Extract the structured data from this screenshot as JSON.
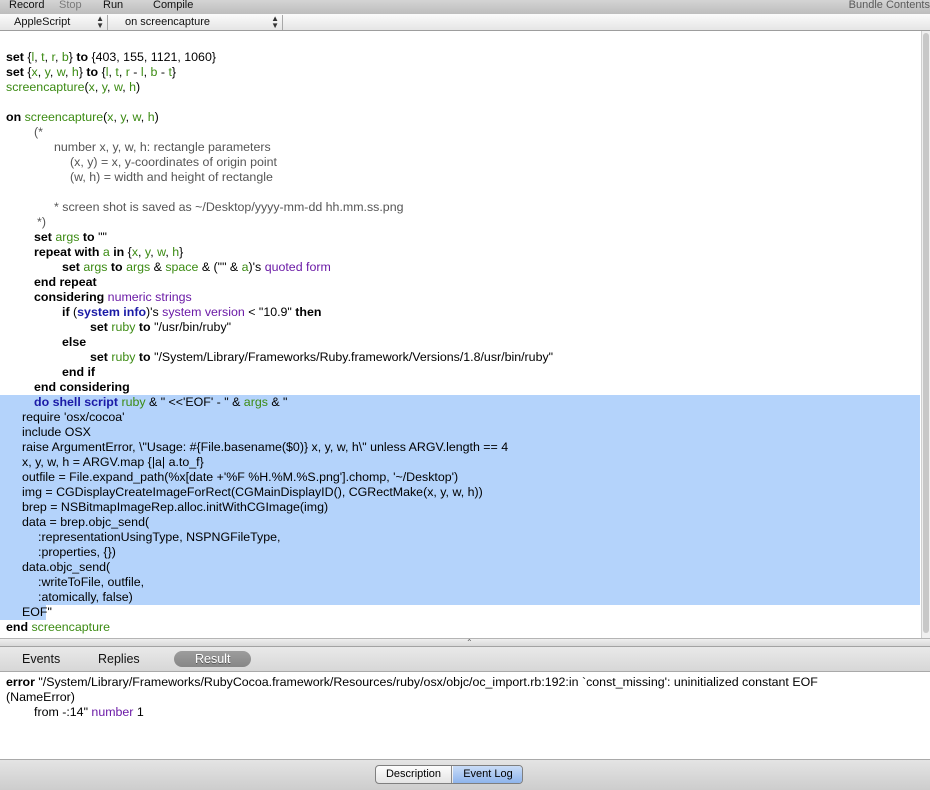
{
  "toolbar": {
    "record": "Record",
    "stop": "Stop",
    "run": "Run",
    "compile": "Compile",
    "bundle_contents": "Bundle Contents"
  },
  "navbar": {
    "language": "AppleScript",
    "handler": "on screencapture"
  },
  "code": {
    "l1": [
      "set ",
      "{",
      "l",
      ", ",
      "t",
      ", ",
      "r",
      ", ",
      "b",
      "} ",
      "to",
      " {403, 155, 1121, 1060}"
    ],
    "l2": [
      "set ",
      "{",
      "x",
      ", ",
      "y",
      ", ",
      "w",
      ", ",
      "h",
      "} ",
      "to",
      " {",
      "l",
      ", ",
      "t",
      ", ",
      "r",
      " - ",
      "l",
      ", ",
      "b",
      " - ",
      "t",
      "}"
    ],
    "l3": [
      "screencapture",
      "(",
      "x",
      ", ",
      "y",
      ", ",
      "w",
      ", ",
      "h",
      ")"
    ],
    "l5": [
      "on ",
      "screencapture",
      "(",
      "x",
      ", ",
      "y",
      ", ",
      "w",
      ", ",
      "h",
      ")"
    ],
    "c1": "(*",
    "c2": "number x, y, w, h: rectangle parameters",
    "c3": "(x, y) = x, y-coordinates of origin point",
    "c4": "(w, h) = width and height of rectangle",
    "c5": "* screen shot is saved as ~/Desktop/yyyy-mm-dd hh.mm.ss.png",
    "c6": "*)",
    "s1": [
      "set ",
      "args",
      " to ",
      "\"\""
    ],
    "s2": [
      "repeat with ",
      "a",
      " in ",
      "{",
      "x",
      ", ",
      "y",
      ", ",
      "w",
      ", ",
      "h",
      "}"
    ],
    "s3": [
      "set ",
      "args",
      " to ",
      "args",
      " & ",
      "space",
      " & (\"\" & ",
      "a",
      ")'s ",
      "quoted form"
    ],
    "s4": "end repeat",
    "s5": [
      "considering ",
      "numeric strings"
    ],
    "s6": [
      "if ",
      "(",
      "system info",
      ")'s ",
      "system version",
      " < \"10.9\" ",
      "then"
    ],
    "s7": [
      "set ",
      "ruby",
      " to ",
      "\"/usr/bin/ruby\""
    ],
    "s8": "else",
    "s9": [
      "set ",
      "ruby",
      " to ",
      "\"/System/Library/Frameworks/Ruby.framework/Versions/1.8/usr/bin/ruby\""
    ],
    "s10": "end if",
    "s11": "end considering",
    "s12": [
      "do shell script ",
      "ruby",
      " & \" <<'EOF' - \" & ",
      "args",
      " & \""
    ],
    "r1": "require 'osx/cocoa'",
    "r2": "include OSX",
    "r3": "raise ArgumentError, \\\"Usage: #{File.basename($0)} x, y, w, h\\\" unless ARGV.length == 4",
    "r4": "x, y, w, h = ARGV.map {|a| a.to_f}",
    "r5": "outfile = File.expand_path(%x[date +'%F %H.%M.%S.png'].chomp, '~/Desktop')",
    "r6": "img = CGDisplayCreateImageForRect(CGMainDisplayID(), CGRectMake(x, y, w, h))",
    "r7": "brep = NSBitmapImageRep.alloc.initWithCGImage(img)",
    "r8": "data = brep.objc_send(",
    "r9": ":representationUsingType, NSPNGFileType,",
    "r10": ":properties, {})",
    "r11": "data.objc_send(",
    "r12": ":writeToFile, outfile,",
    "r13": ":atomically, false)",
    "r14": "EOF\"",
    "e1": [
      "end ",
      "screencapture"
    ]
  },
  "log_tabs": {
    "events": "Events",
    "replies": "Replies",
    "result": "Result"
  },
  "result": {
    "error_kw": "error",
    "error_msg": " \"/System/Library/Frameworks/RubyCocoa.framework/Resources/ruby/osx/objc/oc_import.rb:192:in `const_missing': uninitialized constant EOF",
    "error_msg2": "(NameError)",
    "from_text": "from -:14\" ",
    "number_kw": "number",
    "number_val": " 1"
  },
  "bottom": {
    "description": "Description",
    "event_log": "Event Log"
  }
}
